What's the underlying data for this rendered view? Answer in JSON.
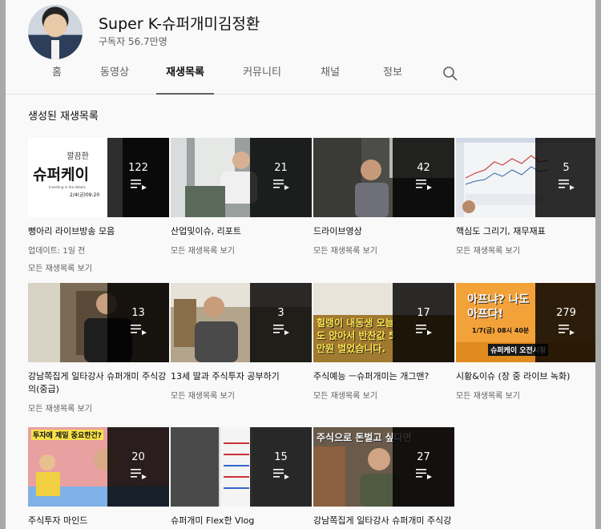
{
  "channel": {
    "name": "Super K-슈퍼개미김정환",
    "subscribers": "구독자 56.7만명"
  },
  "tabs": [
    {
      "label": "홈"
    },
    {
      "label": "동영상"
    },
    {
      "label": "재생목록",
      "active": true
    },
    {
      "label": "커뮤니티"
    },
    {
      "label": "채널"
    },
    {
      "label": "정보"
    }
  ],
  "section": {
    "title": "생성된 재생목록"
  },
  "playlists": [
    {
      "title": "뻥아리 라이브방송 모음",
      "count": "122",
      "updated": "업데이트: 1일 전",
      "link": "모든 재생목록 보기",
      "thumb_text": "슈퍼케이",
      "thumb_sub": "Investing in the details",
      "thumb_date": "2/4(금)09:20",
      "thumb_top": "깔끔한"
    },
    {
      "title": "산업및이슈, 리포트",
      "count": "21",
      "link": "모든 재생목록 보기"
    },
    {
      "title": "드라이브영상",
      "count": "42",
      "link": "모든 재생목록 보기"
    },
    {
      "title": "핵심도 그리기, 재무재표",
      "count": "5",
      "link": "모든 재생목록 보기"
    },
    {
      "title": "강남쪽집게 일타강사 슈퍼개미 주식강의(중급)",
      "count": "13",
      "link": "모든 재생목록 보기"
    },
    {
      "title": "13세 딸과 주식투자 공부하기",
      "count": "3",
      "link": "모든 재생목록 보기"
    },
    {
      "title": "주식예능 ㅡ슈퍼개미는 개그맨?",
      "count": "17",
      "link": "모든 재생목록 보기",
      "thumb_text": "헐랭이 내동생 오늘도 앉아서 반찬값 5만원 벌었습니다."
    },
    {
      "title": "시황&이슈 (장 중 라이브 녹화)",
      "count": "279",
      "link": "모든 재생목록 보기",
      "thumb_text": "아프냐? 나도 아프다!",
      "thumb_sub": "1/7(금) 08시 40분",
      "thumb_badge": "슈퍼케이 오전시황"
    },
    {
      "title": "주식투자 마인드",
      "count": "20",
      "thumb_text": "투자에 제일 중요한건?"
    },
    {
      "title": "슈퍼개미 Flex한 Vlog",
      "count": "15"
    },
    {
      "title": "강남쪽집게 일타강사 슈퍼개미 주식강",
      "count": "27",
      "thumb_text": "주식으로 돈벌고 싶다면"
    }
  ],
  "colors": {
    "accent": "#0f0f0f",
    "overlay": "#000000",
    "meta": "#606060"
  }
}
